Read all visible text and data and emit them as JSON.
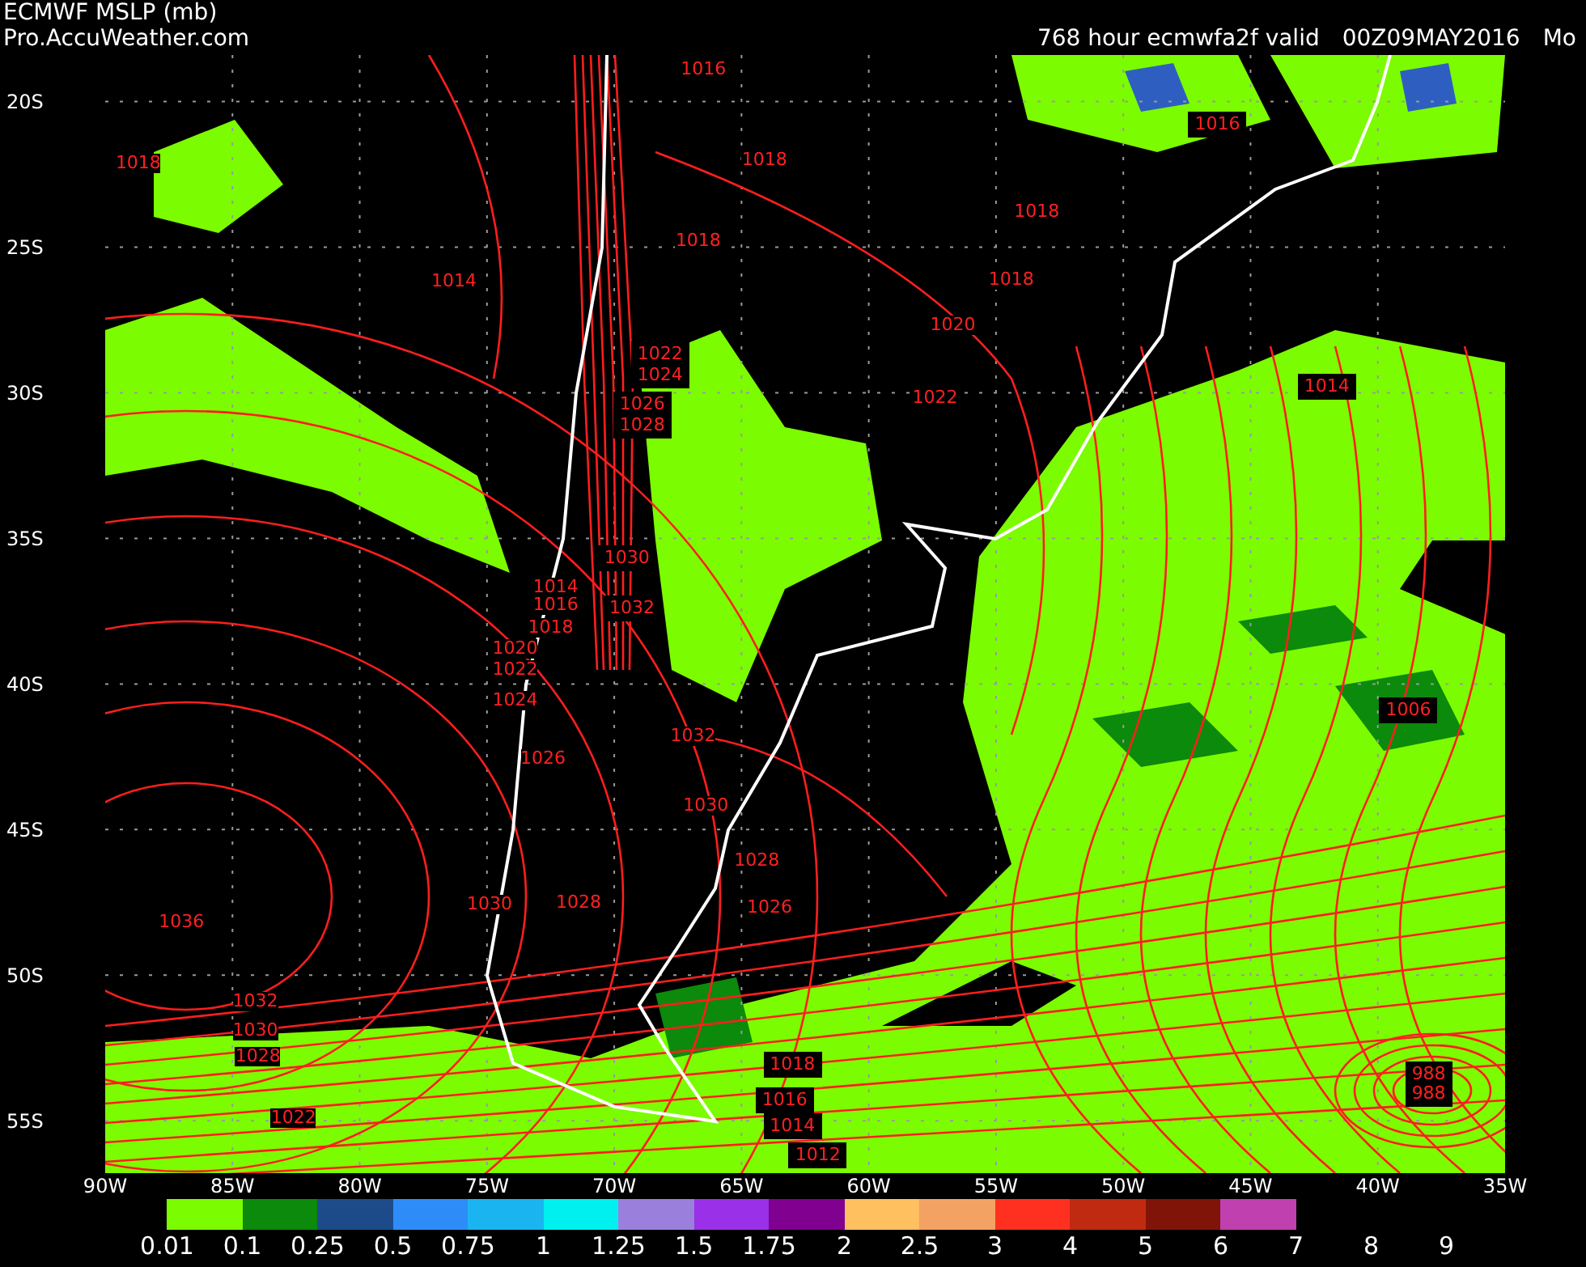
{
  "header": {
    "title": "ECMWF MSLP (mb)",
    "source": "Pro.AccuWeather.com",
    "run": "768 hour ecmwfa2f valid",
    "valid_time": "00Z09MAY2016",
    "weekday": "Mo"
  },
  "map": {
    "isobar_labels": [
      {
        "text": "1016",
        "boxed": false
      },
      {
        "text": "1016",
        "boxed": true
      },
      {
        "text": "1018",
        "boxed": false
      },
      {
        "text": "1018",
        "boxed": false
      },
      {
        "text": "1018",
        "boxed": false
      },
      {
        "text": "1018",
        "boxed": false
      },
      {
        "text": "1018",
        "boxed": false
      },
      {
        "text": "1014",
        "boxed": false
      },
      {
        "text": "1020",
        "boxed": false
      },
      {
        "text": "1022",
        "boxed": true
      },
      {
        "text": "1024",
        "boxed": true
      },
      {
        "text": "1014",
        "boxed": true
      },
      {
        "text": "1022",
        "boxed": false
      },
      {
        "text": "1026",
        "boxed": true
      },
      {
        "text": "1028",
        "boxed": true
      },
      {
        "text": "1030",
        "boxed": true
      },
      {
        "text": "1014",
        "boxed": false
      },
      {
        "text": "1016",
        "boxed": false
      },
      {
        "text": "1032",
        "boxed": true
      },
      {
        "text": "1018",
        "boxed": false
      },
      {
        "text": "1020",
        "boxed": false
      },
      {
        "text": "1022",
        "boxed": false
      },
      {
        "text": "1024",
        "boxed": false
      },
      {
        "text": "1006",
        "boxed": true
      },
      {
        "text": "1032",
        "boxed": false
      },
      {
        "text": "1026",
        "boxed": false
      },
      {
        "text": "1030",
        "boxed": false
      },
      {
        "text": "1028",
        "boxed": false
      },
      {
        "text": "1030",
        "boxed": false
      },
      {
        "text": "1028",
        "boxed": false
      },
      {
        "text": "1026",
        "boxed": false
      },
      {
        "text": "1036",
        "boxed": false
      },
      {
        "text": "1032",
        "boxed": false
      },
      {
        "text": "1030",
        "boxed": false
      },
      {
        "text": "1028",
        "boxed": false
      },
      {
        "text": "1018",
        "boxed": true
      },
      {
        "text": "988",
        "boxed": true
      },
      {
        "text": "1016",
        "boxed": true
      },
      {
        "text": "988",
        "boxed": true
      },
      {
        "text": "1022",
        "boxed": false
      },
      {
        "text": "1014",
        "boxed": true
      },
      {
        "text": "1012",
        "boxed": true
      }
    ]
  },
  "axes": {
    "lat_ticks": [
      "20S",
      "25S",
      "30S",
      "35S",
      "40S",
      "45S",
      "50S",
      "55S"
    ],
    "lon_ticks": [
      "90W",
      "85W",
      "80W",
      "75W",
      "70W",
      "65W",
      "60W",
      "55W",
      "50W",
      "45W",
      "40W",
      "35W"
    ]
  },
  "legend": {
    "swatches": [
      {
        "color": "#7cfc00"
      },
      {
        "color": "#0b8a0b"
      },
      {
        "color": "#1d4b8a"
      },
      {
        "color": "#2e8cf8"
      },
      {
        "color": "#1ab4f0"
      },
      {
        "color": "#00f0f0"
      },
      {
        "color": "#9a80dc"
      },
      {
        "color": "#9a30e8"
      },
      {
        "color": "#800090"
      },
      {
        "color": "#ffc060"
      },
      {
        "color": "#f4a264"
      },
      {
        "color": "#ff3020"
      },
      {
        "color": "#c02a10"
      },
      {
        "color": "#801408"
      },
      {
        "color": "#c040b0"
      }
    ],
    "labels": [
      "0.01",
      "0.1",
      "0.25",
      "0.5",
      "0.75",
      "1",
      "1.25",
      "1.5",
      "1.75",
      "2",
      "2.5",
      "3",
      "4",
      "5",
      "6",
      "7",
      "8",
      "9"
    ]
  }
}
